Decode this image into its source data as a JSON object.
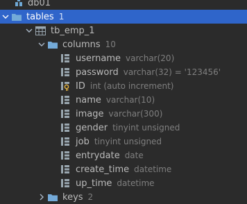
{
  "tree": {
    "database": {
      "name": "db01",
      "expanded": true
    },
    "tables_folder": {
      "name": "tables",
      "count": "1",
      "expanded": true,
      "selected": true
    },
    "table": {
      "name": "tb_emp_1",
      "expanded": true
    },
    "columns_folder": {
      "name": "columns",
      "count": "10",
      "expanded": true
    },
    "columns": [
      {
        "name": "username",
        "type": "varchar(20)"
      },
      {
        "name": "password",
        "type": "varchar(32) = '123456'"
      },
      {
        "name": "ID",
        "type": "int (auto increment)"
      },
      {
        "name": "name",
        "type": "varchar(10)"
      },
      {
        "name": "image",
        "type": "varchar(300)"
      },
      {
        "name": "gender",
        "type": "tinyint unsigned"
      },
      {
        "name": "job",
        "type": "tinyint unsigned"
      },
      {
        "name": "entrydate",
        "type": "date"
      },
      {
        "name": "create_time",
        "type": "datetime"
      },
      {
        "name": "up_time",
        "type": "datetime"
      }
    ],
    "keys_folder": {
      "name": "keys",
      "count": "2",
      "expanded": false
    }
  },
  "colors": {
    "background": "#2b2b2b",
    "selection": "#2f65ca",
    "folder": "#74aad8",
    "database": "#6fa9d6",
    "column_icon": "#9aa7b0",
    "primary_key": "#e3b341",
    "muted_text": "#7f7f7f"
  },
  "icons": {
    "database": "database-icon",
    "folder": "folder-icon",
    "table": "table-icon",
    "column": "column-icon",
    "primary_key_column": "primary-key-column-icon",
    "expanded": "chevron-down-icon",
    "collapsed": "chevron-right-icon"
  }
}
